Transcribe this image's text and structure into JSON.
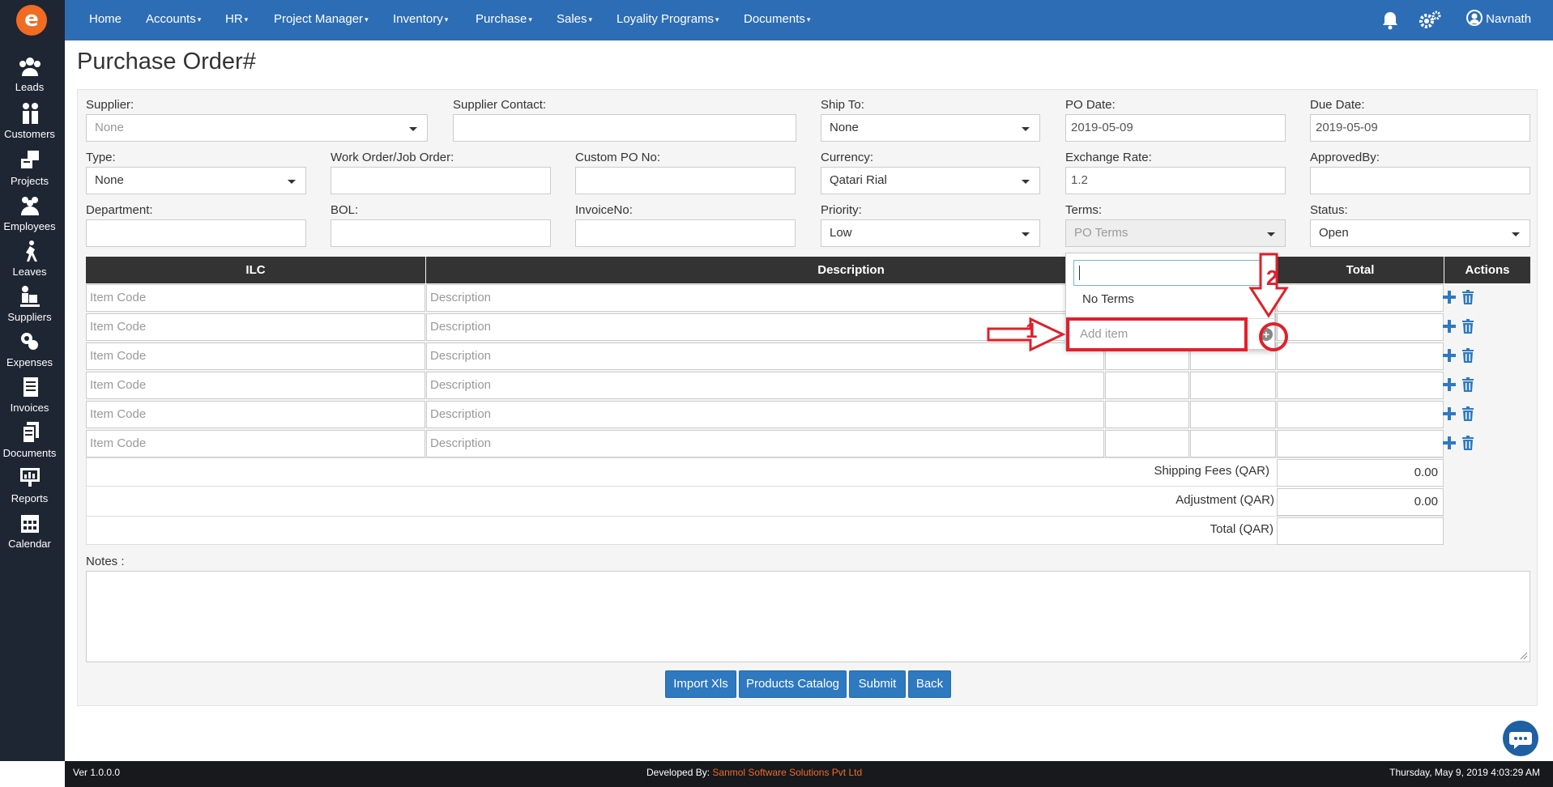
{
  "sidebar": {
    "items": [
      {
        "label": "Leads",
        "icon": "leads-icon"
      },
      {
        "label": "Customers",
        "icon": "customers-icon"
      },
      {
        "label": "Projects",
        "icon": "projects-icon"
      },
      {
        "label": "Employees",
        "icon": "employees-icon"
      },
      {
        "label": "Leaves",
        "icon": "leaves-icon"
      },
      {
        "label": "Suppliers",
        "icon": "suppliers-icon"
      },
      {
        "label": "Expenses",
        "icon": "expenses-icon"
      },
      {
        "label": "Invoices",
        "icon": "invoices-icon"
      },
      {
        "label": "Documents",
        "icon": "documents-icon"
      },
      {
        "label": "Reports",
        "icon": "reports-icon"
      },
      {
        "label": "Calendar",
        "icon": "calendar-icon"
      }
    ]
  },
  "nav": {
    "items": [
      "Home",
      "Accounts",
      "HR",
      "Project Manager",
      "Inventory",
      "Purchase",
      "Sales",
      "Loyality Programs",
      "Documents"
    ],
    "user": "Navnath"
  },
  "page": {
    "title": "Purchase Order#"
  },
  "form": {
    "supplier_label": "Supplier:",
    "supplier_value": "None",
    "supplier_contact_label": "Supplier Contact:",
    "ship_to_label": "Ship To:",
    "ship_to_value": "None",
    "po_date_label": "PO Date:",
    "po_date_value": "2019-05-09",
    "due_date_label": "Due Date:",
    "due_date_value": "2019-05-09",
    "type_label": "Type:",
    "type_value": "None",
    "work_order_label": "Work Order/Job Order:",
    "custom_po_label": "Custom PO No:",
    "currency_label": "Currency:",
    "currency_value": "Qatari Rial",
    "exchange_rate_label": "Exchange Rate:",
    "exchange_rate_value": "1.2",
    "approved_by_label": "ApprovedBy:",
    "department_label": "Department:",
    "bol_label": "BOL:",
    "invoice_no_label": "InvoiceNo:",
    "priority_label": "Priority:",
    "priority_value": "Low",
    "terms_label": "Terms:",
    "terms_placeholder": "PO Terms",
    "status_label": "Status:",
    "status_value": "Open"
  },
  "table": {
    "headers": {
      "ilc": "ILC",
      "description": "Description",
      "total": "Total",
      "actions": "Actions"
    },
    "item_code_placeholder": "Item Code",
    "description_placeholder": "Description",
    "shipping_label": "Shipping Fees (QAR)",
    "shipping_value": "0.00",
    "adjustment_label": "Adjustment (QAR)",
    "adjustment_value": "0.00",
    "total_label": "Total (QAR)"
  },
  "notes_label": "Notes :",
  "buttons": {
    "import": "Import Xls",
    "catalog": "Products Catalog",
    "submit": "Submit",
    "back": "Back"
  },
  "dropdown": {
    "option_none": "No Terms",
    "add_placeholder": "Add item"
  },
  "annotations": {
    "one": "1",
    "two": "2"
  },
  "footer": {
    "version": "Ver 1.0.0.0",
    "developed_prefix": "Developed By:",
    "developer": "Sanmol Software Solutions Pvt Ltd",
    "datetime": "Thursday, May 9, 2019 4:03:29 AM"
  },
  "colors": {
    "nav": "#2d6db5",
    "sidebar": "#1e2633",
    "accent": "#2e79c0",
    "annotation": "#e0202b",
    "developer": "#f26b23"
  }
}
